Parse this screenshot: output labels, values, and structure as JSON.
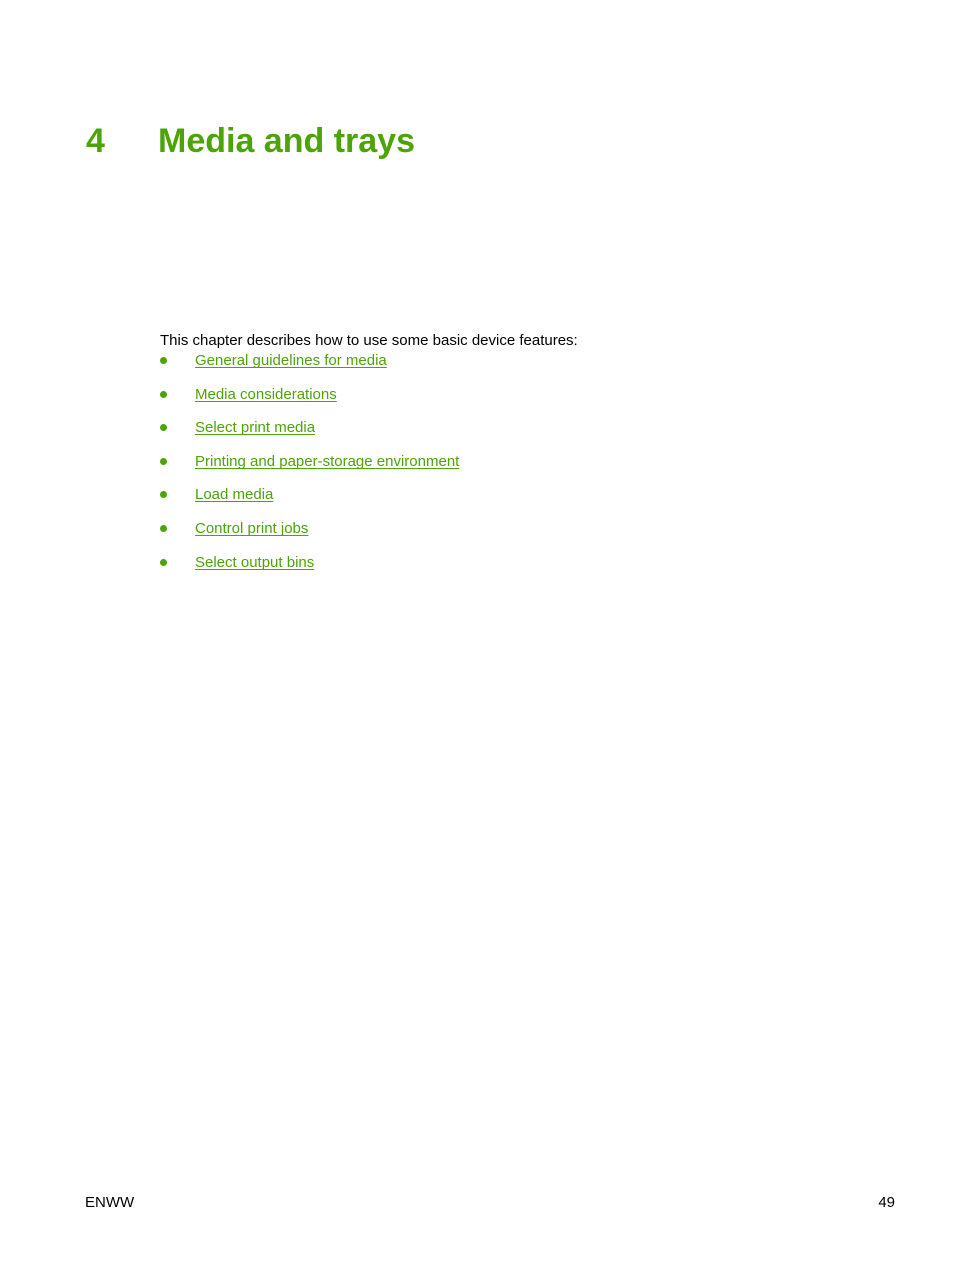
{
  "document": {
    "chapter_number": "4",
    "chapter_title": "Media and trays",
    "intro_text": "This chapter describes how to use some basic device features:",
    "links": [
      {
        "label": "General guidelines for media"
      },
      {
        "label": "Media considerations"
      },
      {
        "label": "Select print media"
      },
      {
        "label": "Printing and paper-storage environment"
      },
      {
        "label": "Load media"
      },
      {
        "label": "Control print jobs"
      },
      {
        "label": "Select output bins"
      }
    ]
  },
  "footer": {
    "locale": "ENWW",
    "page_number": "49"
  },
  "colors": {
    "heading_green": "#4ca409",
    "link_green": "#4ca409",
    "body_black": "#000000",
    "page_background": "#ffffff"
  }
}
